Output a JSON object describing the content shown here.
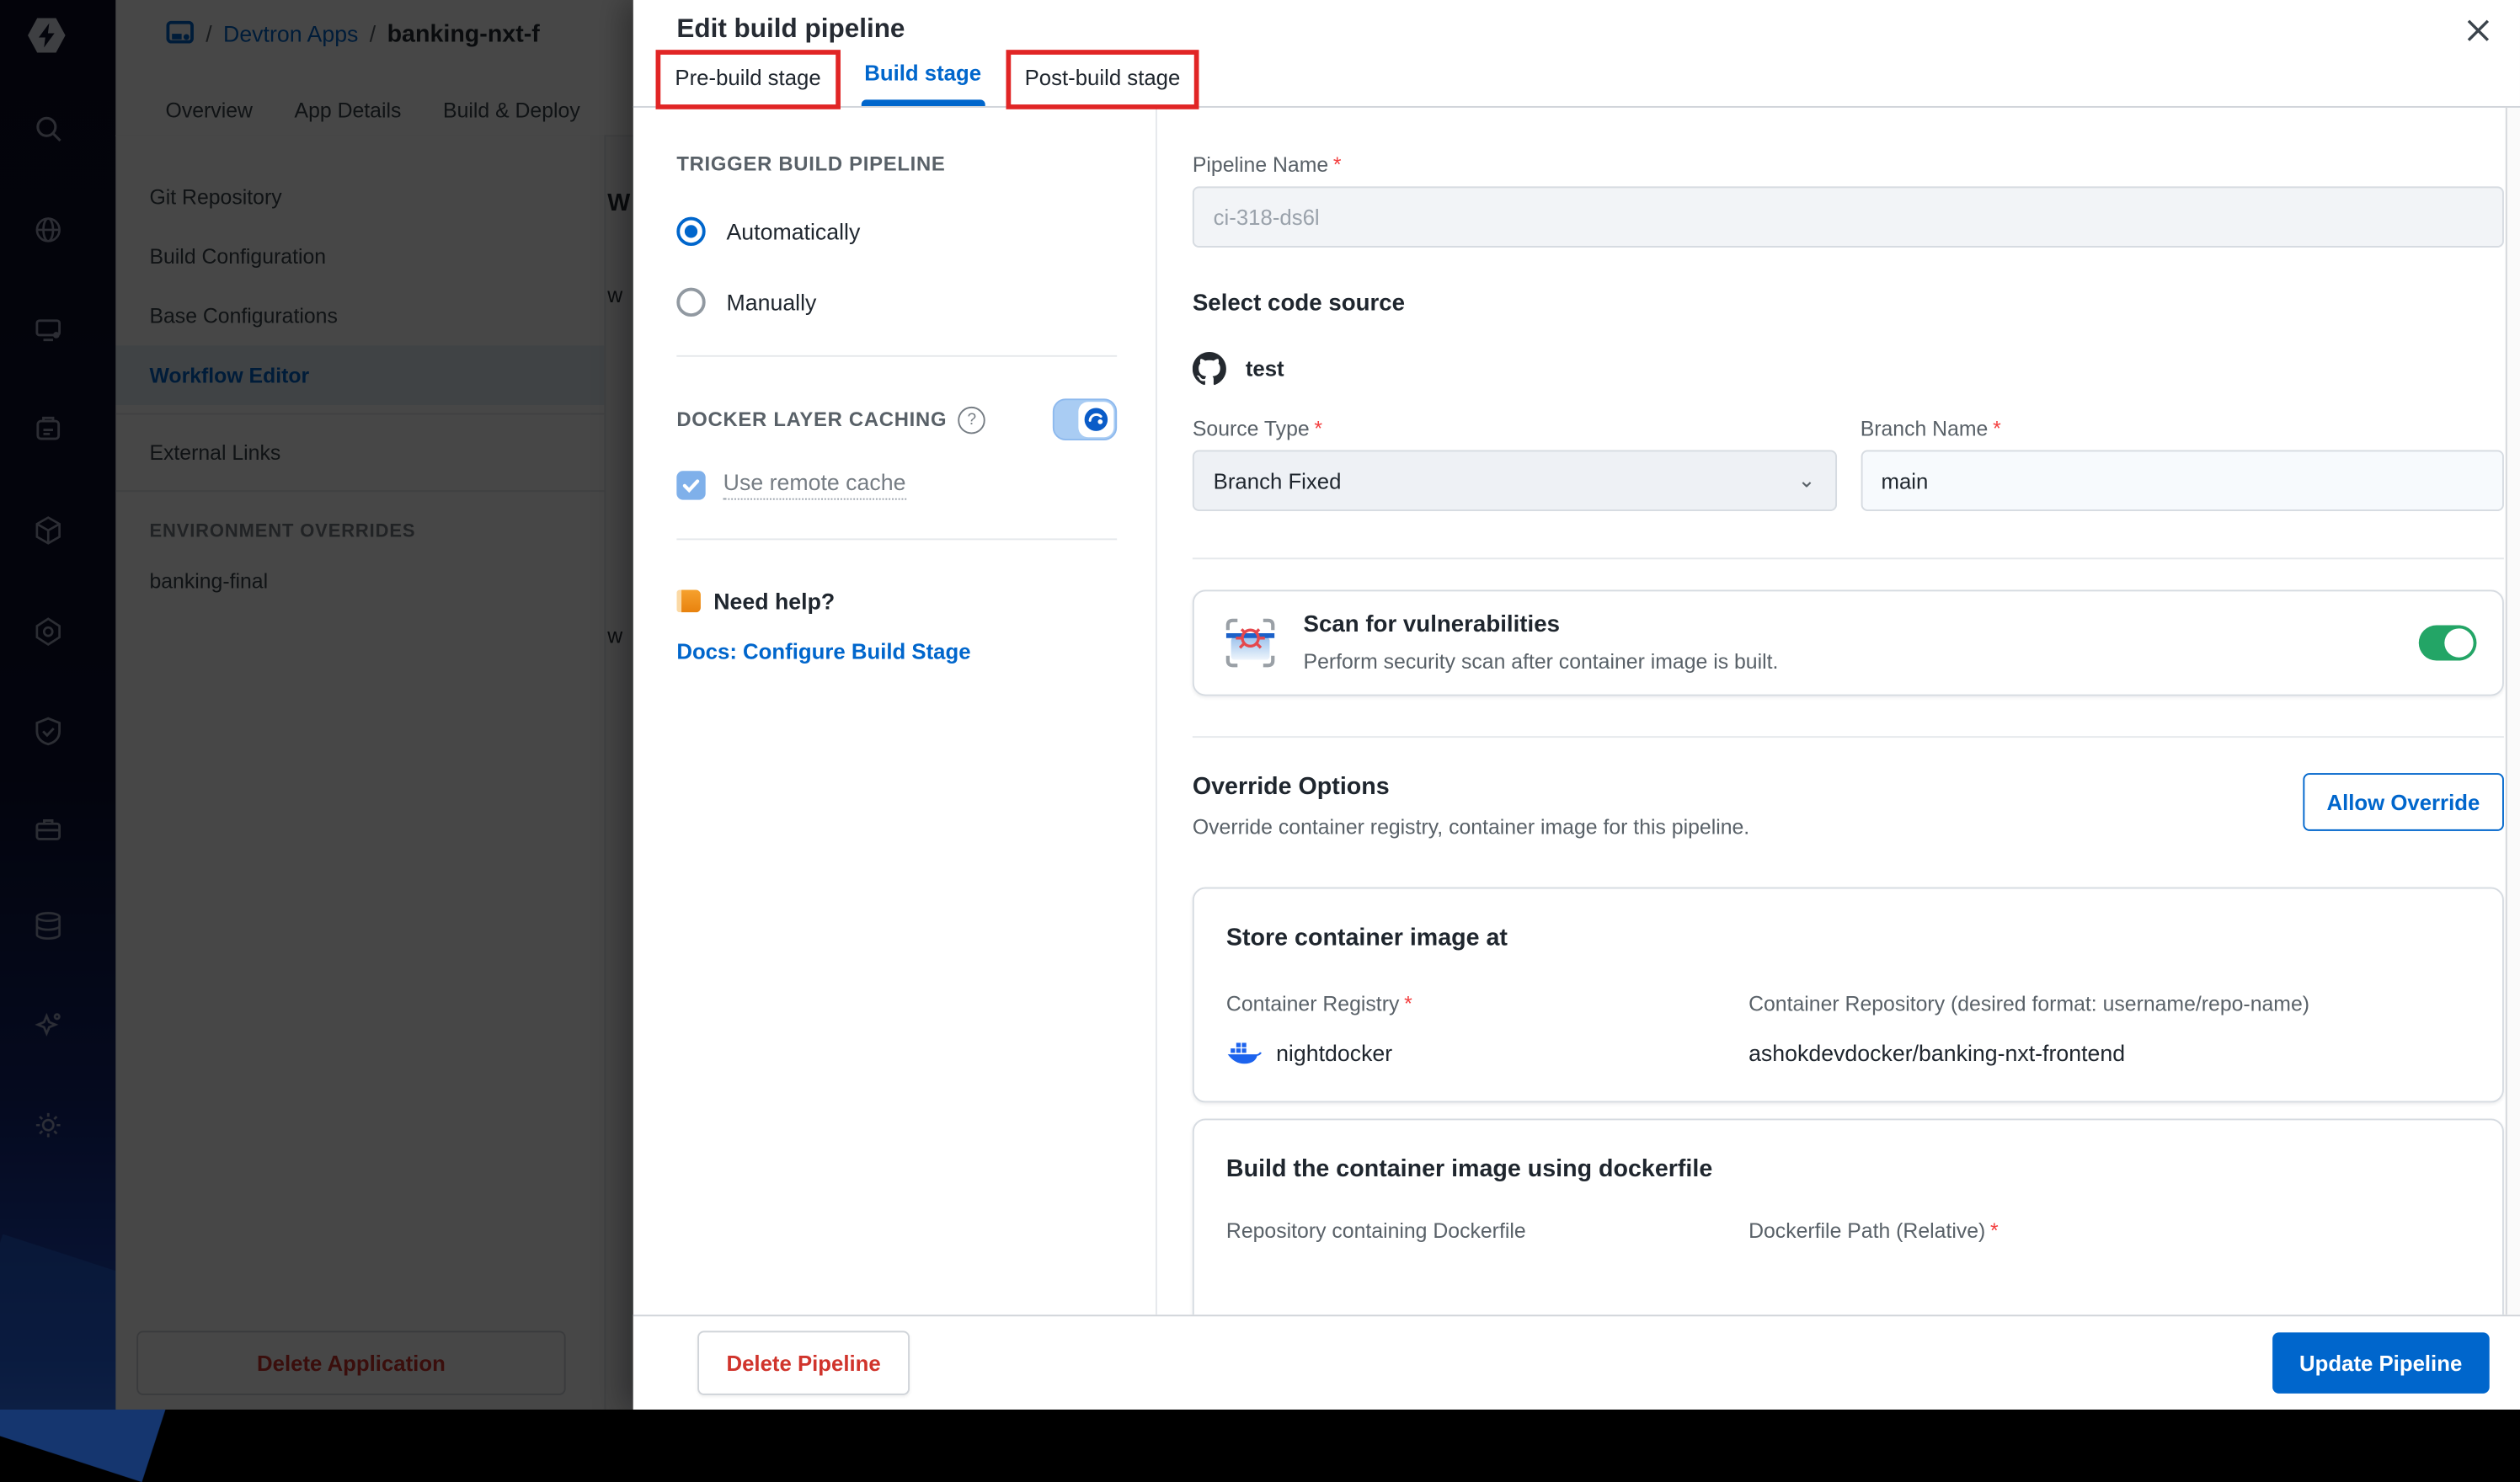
{
  "background": {
    "breadcrumb": {
      "slash1": "/",
      "app_link": "Devtron Apps",
      "slash2": "/",
      "app_name": "banking-nxt-f"
    },
    "tabs": [
      {
        "label": "Overview"
      },
      {
        "label": "App Details"
      },
      {
        "label": "Build & Deploy"
      }
    ],
    "nav": {
      "items": [
        {
          "label": "Git Repository"
        },
        {
          "label": "Build Configuration"
        },
        {
          "label": "Base Configurations"
        },
        {
          "label": "Workflow Editor"
        },
        {
          "label": "External Links"
        }
      ],
      "active_item": "Workflow Editor",
      "section_header": "ENVIRONMENT OVERRIDES",
      "environment": "banking-final",
      "delete_button": "Delete Application"
    },
    "content_fragments": {
      "f1": "W",
      "f2": "w",
      "f3": "w"
    }
  },
  "modal": {
    "title": "Edit build pipeline",
    "close_glyph": "✕",
    "tabs": [
      {
        "label": "Pre-build stage"
      },
      {
        "label": "Build stage"
      },
      {
        "label": "Post-build stage"
      }
    ],
    "active_tab": "Build stage",
    "required_marker": "*",
    "left_panel": {
      "trigger_heading": "TRIGGER BUILD PIPELINE",
      "radio_auto": "Automatically",
      "radio_manual": "Manually",
      "dlc_heading": "DOCKER LAYER CACHING",
      "help_glyph": "?",
      "remote_cache_label": "Use remote cache",
      "help_heading": "Need help?",
      "docs_link": "Docs: Configure Build Stage"
    },
    "form": {
      "pipeline_name_label": "Pipeline Name",
      "pipeline_name_value": "ci-318-ds6l",
      "code_source_heading": "Select code source",
      "repo_name": "test",
      "source_type_label": "Source Type",
      "source_type_value": "Branch Fixed",
      "chevron_glyph": "⌄",
      "branch_name_label": "Branch Name",
      "branch_name_value": "main",
      "scan_title": "Scan for vulnerabilities",
      "scan_subtitle": "Perform security scan after container image is built.",
      "override_title": "Override Options",
      "override_subtitle": "Override container registry, container image for this pipeline.",
      "allow_override_button": "Allow Override",
      "store_card": {
        "title": "Store container image at",
        "registry_label": "Container Registry",
        "registry_value": "nightdocker",
        "repository_label": "Container Repository (desired format: username/repo-name)",
        "repository_value": "ashokdevdocker/banking-nxt-frontend"
      },
      "build_card": {
        "title": "Build the container image using dockerfile",
        "repo_label": "Repository containing Dockerfile",
        "dockerfile_path_label": "Dockerfile Path (Relative)"
      }
    },
    "footer": {
      "delete_button": "Delete Pipeline",
      "update_button": "Update Pipeline"
    }
  },
  "colors": {
    "primary_blue": "#0066cc",
    "annotation_red": "#e12525",
    "toggle_green": "#23a566",
    "danger_red": "#d0342c",
    "sidebar_navy": "#0b0e26",
    "docker_blue": "#1d63ed"
  }
}
